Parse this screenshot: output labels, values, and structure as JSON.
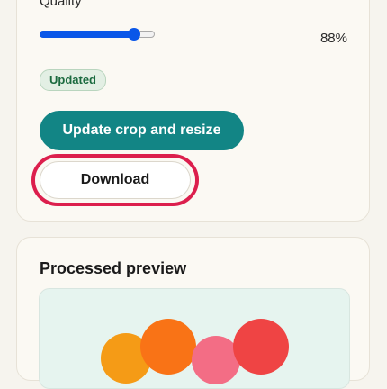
{
  "controls": {
    "quality_label": "Quality",
    "quality_value_text": "88%",
    "quality_fraction": 0.82,
    "status_badge": "Updated",
    "update_button": "Update crop and resize",
    "download_button": "Download"
  },
  "preview": {
    "title": "Processed preview",
    "shapes": [
      "orange-circle",
      "dark-orange-circle",
      "pink-circle",
      "red-circle"
    ]
  },
  "colors": {
    "accent": "#128585",
    "slider": "#0a57e8",
    "highlight_ring": "#dc1f4d",
    "badge_text": "#1b6a3f"
  }
}
